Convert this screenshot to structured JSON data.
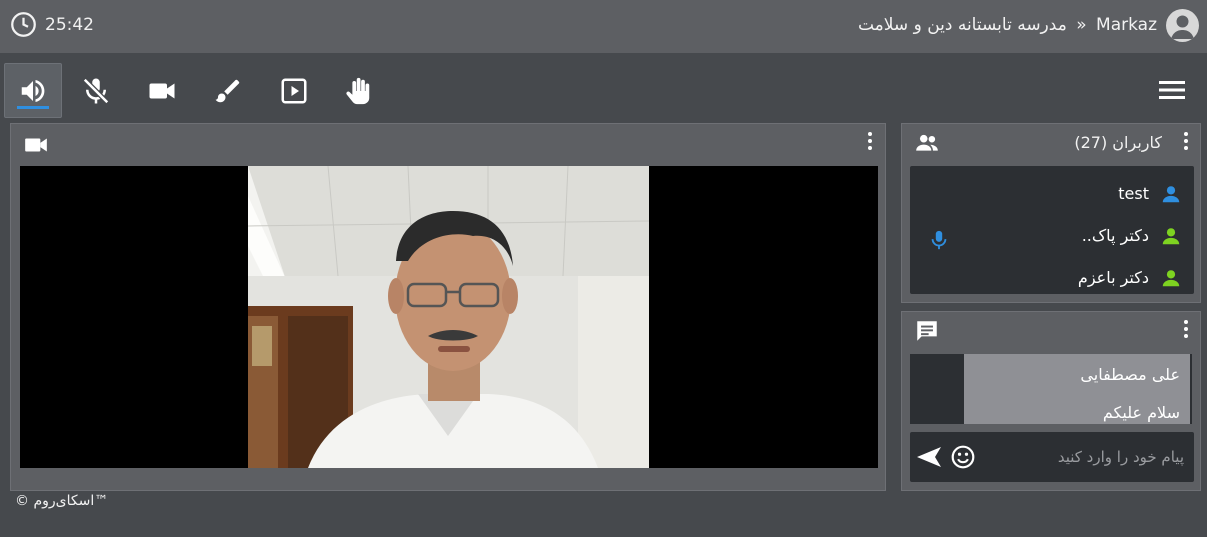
{
  "header": {
    "timer": "25:42",
    "app_name": "Markaz",
    "separator": "»",
    "room_title": "مدرسه تابستانه دین و سلامت"
  },
  "toolbar": {
    "tools": [
      {
        "name": "speaker",
        "active": true
      },
      {
        "name": "microphone-muted",
        "active": false
      },
      {
        "name": "camera",
        "active": false
      },
      {
        "name": "whiteboard-brush",
        "active": false
      },
      {
        "name": "presentation",
        "active": false
      },
      {
        "name": "raise-hand",
        "active": false
      }
    ]
  },
  "users": {
    "title": "کاربران (27)",
    "list": [
      {
        "name": "test",
        "color": "#2f8fe0",
        "mic": false
      },
      {
        "name": "دکتر پاک..",
        "color": "#7ed321",
        "mic": true
      },
      {
        "name": "دکتر باعزم",
        "color": "#7ed321",
        "mic": false
      }
    ]
  },
  "chat": {
    "messages": [
      {
        "author": "علی مصطفایی",
        "text": "سلام علیکم"
      }
    ],
    "input_placeholder": "پیام خود را وارد کنید"
  },
  "footer": {
    "copyright": "© اسکای‌روم™"
  },
  "colors": {
    "accent": "#2f8fe0",
    "online_green": "#7ed321"
  }
}
